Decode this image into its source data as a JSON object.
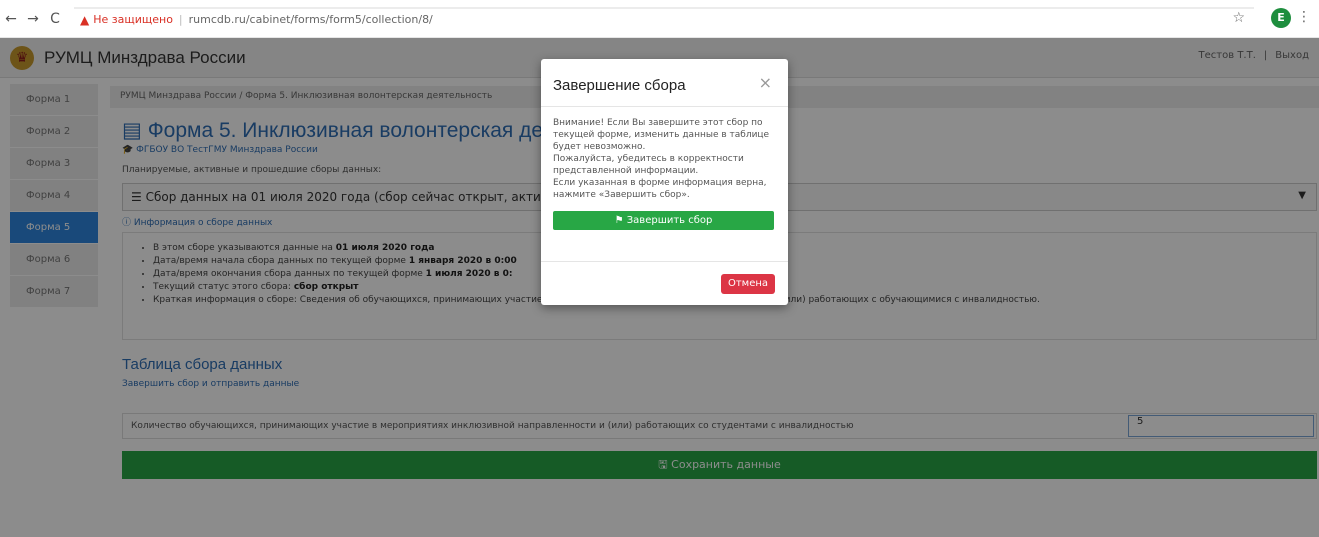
{
  "browser": {
    "security_label": "Не защищено",
    "url": "rumcdb.ru/cabinet/forms/form5/collection/8/",
    "profile_initial": "E"
  },
  "header": {
    "brand": "РУМЦ Минздрава России",
    "user": "Тестов Т.Т.",
    "logout": "Выход"
  },
  "sidebar": {
    "items": [
      {
        "label": "Форма 1"
      },
      {
        "label": "Форма 2"
      },
      {
        "label": "Форма 3"
      },
      {
        "label": "Форма 4"
      },
      {
        "label": "Форма 5"
      },
      {
        "label": "Форма 6"
      },
      {
        "label": "Форма 7"
      }
    ]
  },
  "main": {
    "breadcrumb": "РУМЦ Минздрава России / Форма 5. Инклюзивная волонтерская деятельность",
    "title": "Форма 5. Инклюзивная волонтерская дея",
    "organization": "ФГБОУ ВО ТестГМУ Минздрава России",
    "subtitle": "Планируемые, активные и прошедшие сборы данных:",
    "collection": "Сбор данных на 01 июля 2020 года (сбор сейчас открыт, активе",
    "info_link": "Информация о сборе данных",
    "info": {
      "line1_prefix": "В этом сборе указываются данные на ",
      "line1_bold": "01 июля 2020 года",
      "line2_prefix": "Дата/время начала сбора данных по текущей форме ",
      "line2_bold": "1 января 2020 в 0:00",
      "line3_prefix": "Дата/время окончания сбора данных по текущей форме ",
      "line3_bold": "1 июля 2020 в 0:",
      "line4_prefix": "Текущий статус этого сбора: ",
      "line4_bold": "сбор открыт",
      "line5": "Краткая информация о сборе: Сведения об обучающихся, принимающих участие в мероприятиях инклюзивной направленности и (или) работающих с обучающимися с инвалидностью."
    },
    "section_title": "Таблица сбора данных",
    "section_link": "Завершить сбор и отправить данные",
    "row_label": "Количество обучающихся, принимающих участие в мероприятиях инклюзивной направленности и (или) работающих со студентами с инвалидностью",
    "row_value": "5",
    "save_label": "Сохранить данные"
  },
  "modal": {
    "title": "Завершение сбора",
    "close": "×",
    "text1": "Внимание! Если Вы завершите этот сбор по текущей форме, изменить данные в таблице будет невозможно.",
    "text2": "Пожалуйста, убедитесь в корректности представленной информации.",
    "text3": "Если указанная в форме информация верна, нажмите «Завершить сбор».",
    "confirm_label": "Завершить сбор",
    "cancel_label": "Отмена"
  }
}
